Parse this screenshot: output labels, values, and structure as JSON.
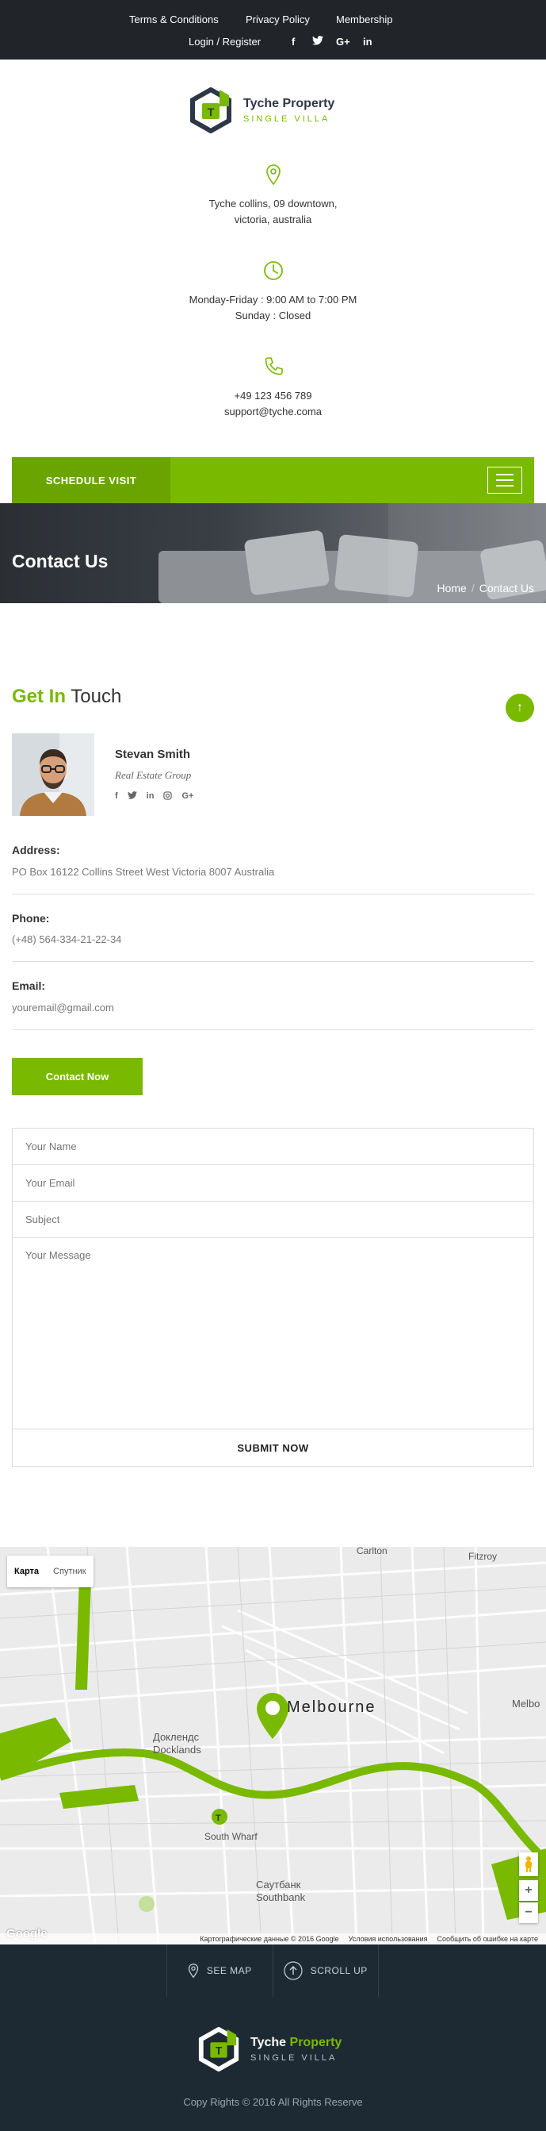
{
  "topbar": {
    "links": [
      "Terms & Conditions",
      "Privacy Policy",
      "Membership",
      "Login / Register"
    ],
    "social": [
      "f",
      "t",
      "G+",
      "in"
    ]
  },
  "brand": {
    "name": "Tyche Property",
    "name_part1": "Tyche",
    "name_part2": "Property",
    "tagline": "SINGLE VILLA",
    "logo_letter": "T",
    "accent": "#79b900",
    "dark": "#2d3748"
  },
  "info": {
    "address_line1": "Tyche collins, 09 downtown,",
    "address_line2": "victoria, australia",
    "hours_line1": "Monday-Friday : 9:00 AM to 7:00 PM",
    "hours_line2": "Sunday : Closed",
    "phone": "+49 123 456 789",
    "email": "support@tyche.coma"
  },
  "nav": {
    "schedule_label": "SCHEDULE VISIT"
  },
  "hero": {
    "title": "Contact Us",
    "breadcrumb_home": "Home",
    "breadcrumb_sep": "/",
    "breadcrumb_current": "Contact Us"
  },
  "section": {
    "title_bold": "Get In",
    "title_rest": " Touch",
    "up_icon": "↑"
  },
  "agent": {
    "name": "Stevan Smith",
    "role": "Real Estate Group",
    "social": [
      "f",
      "t",
      "in",
      "ig",
      "G+"
    ]
  },
  "details": {
    "address_label": "Address:",
    "address_value": "PO Box 16122 Collins Street West Victoria 8007 Australia",
    "phone_label": "Phone:",
    "phone_value": "(+48) 564-334-21-22-34",
    "email_label": "Email:",
    "email_value": "youremail@gmail.com"
  },
  "cta": {
    "contact_now": "Contact Now"
  },
  "form": {
    "name_placeholder": "Your Name",
    "email_placeholder": "Your Email",
    "subject_placeholder": "Subject",
    "message_placeholder": "Your Message",
    "submit_label": "SUBMIT NOW"
  },
  "map": {
    "tab_map": "Карта",
    "tab_satellite": "Спутник",
    "city": "Melbourne",
    "labels": {
      "carlton": "Carlton",
      "fitzroy": "Fitzroy",
      "docklands_ru": "Доклендс",
      "docklands": "Docklands",
      "south_wharf": "South Wharf",
      "southbank_ru": "Саутбанк",
      "southbank": "Southbank",
      "melb_edge": "Melbo"
    },
    "zoom_in": "+",
    "zoom_out": "−",
    "google": "Google",
    "footer_data": "Картографические данные © 2016 Google",
    "footer_terms": "Условия использования",
    "footer_report": "Сообщить об ошибке на карте"
  },
  "footer": {
    "see_map": "SEE MAP",
    "scroll_up": "SCROLL UP",
    "copyright": "Copy Rights © 2016 All Rights Reserve"
  }
}
